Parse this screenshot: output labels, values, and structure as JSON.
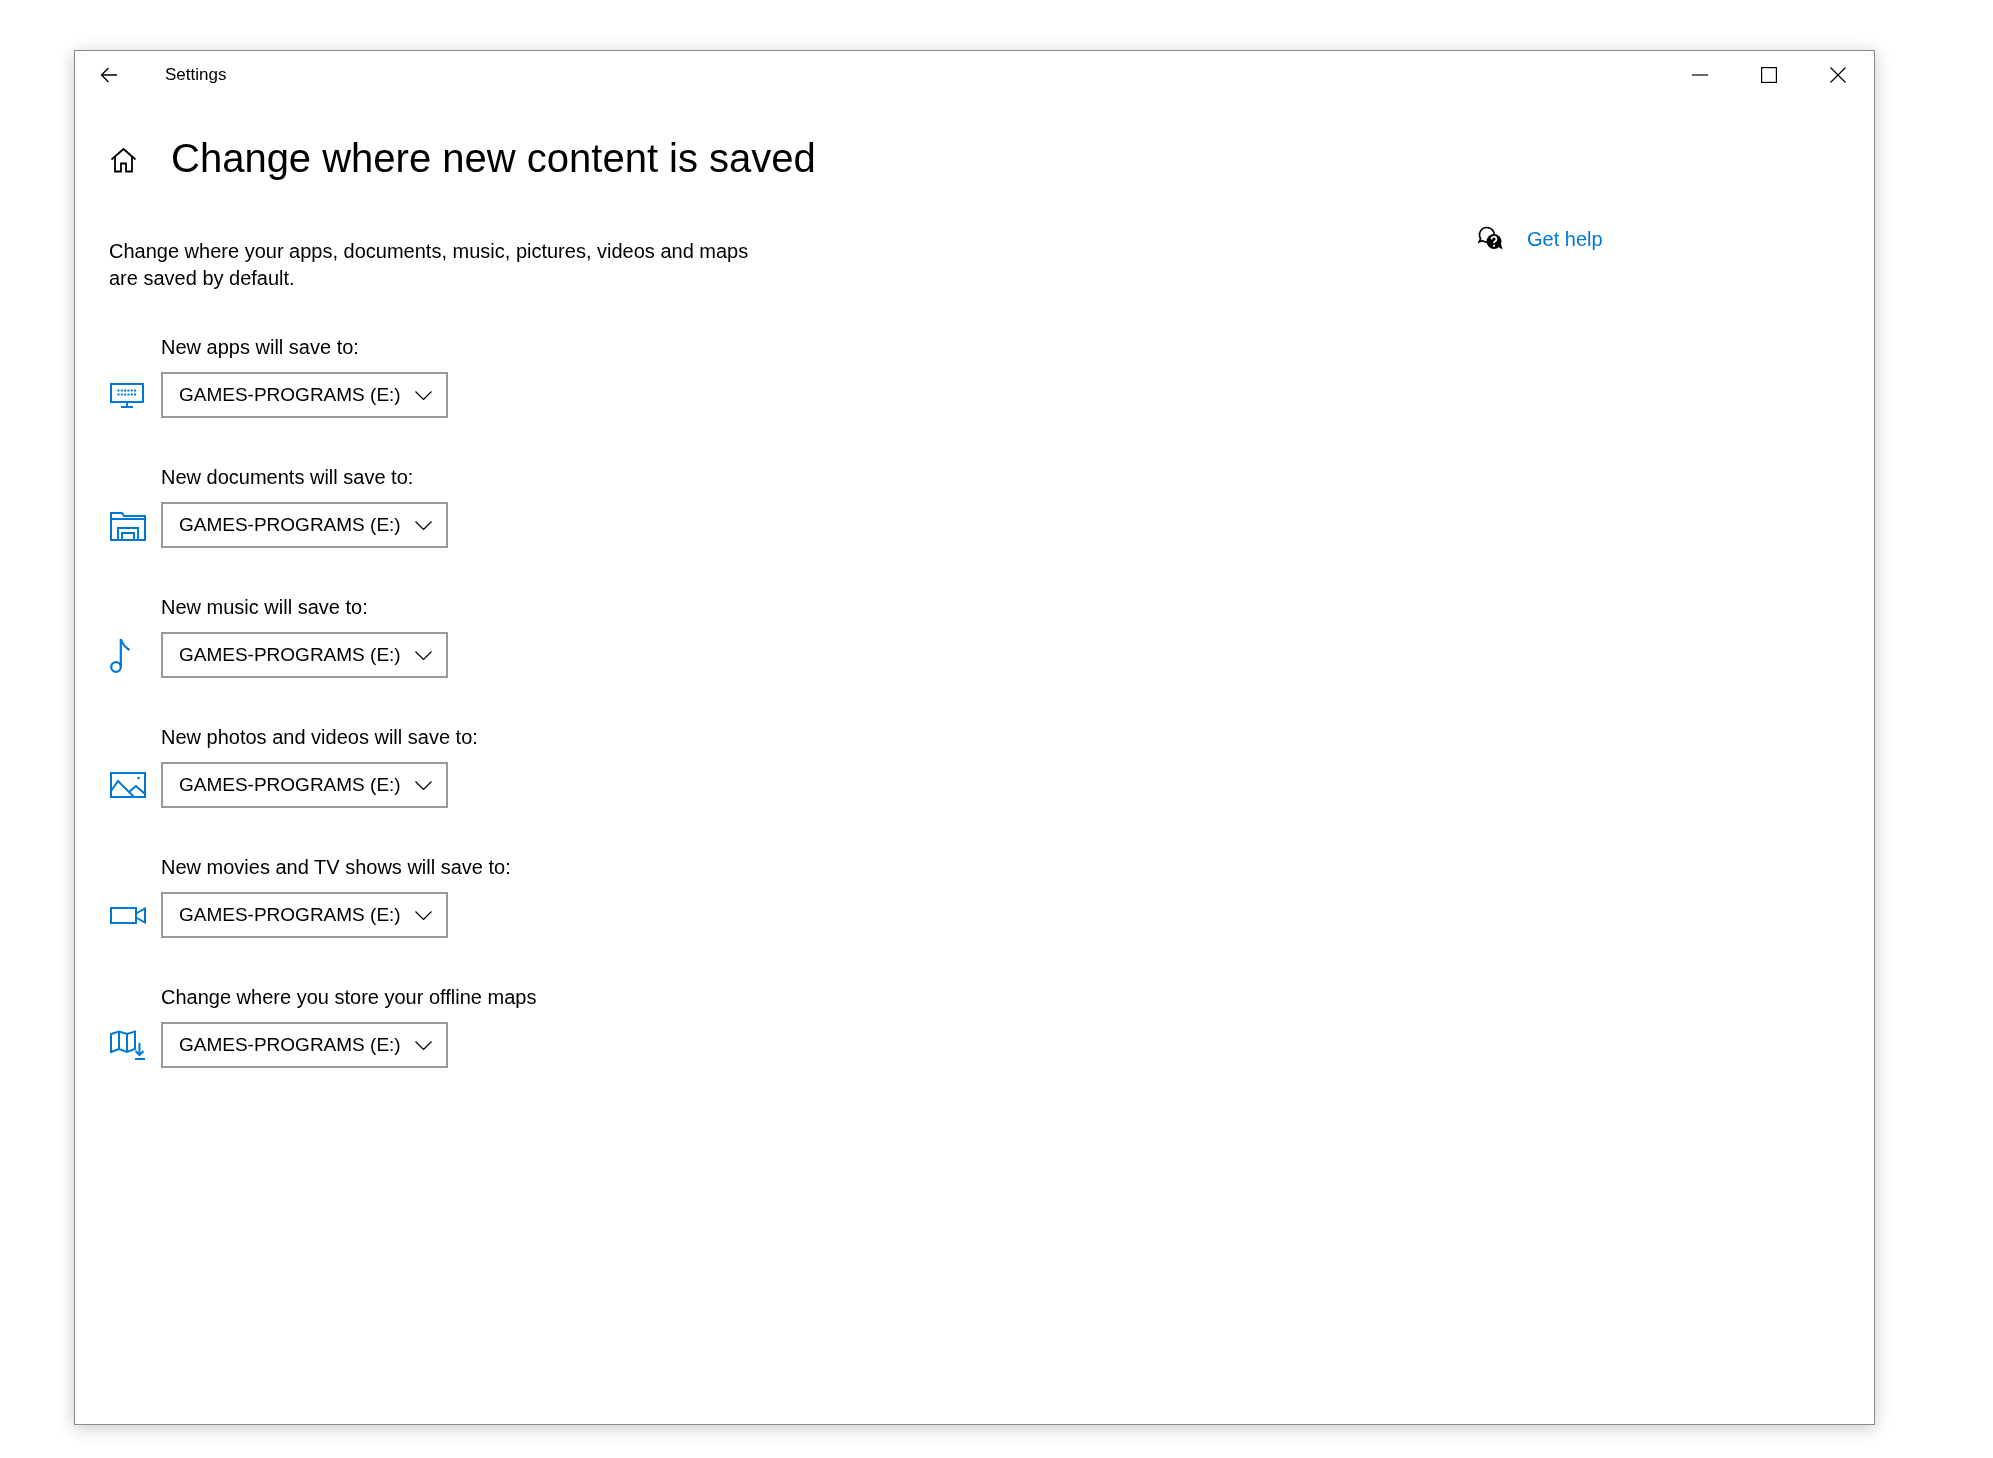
{
  "window": {
    "title": "Settings"
  },
  "page": {
    "title": "Change where new content is saved",
    "description": "Change where your apps, documents, music, pictures, videos and maps are saved by default."
  },
  "help_link": {
    "label": "Get help"
  },
  "locations": [
    {
      "kind": "apps",
      "label": "New apps will save to:",
      "value": "GAMES-PROGRAMS (E:)"
    },
    {
      "kind": "documents",
      "label": "New documents will save to:",
      "value": "GAMES-PROGRAMS (E:)"
    },
    {
      "kind": "music",
      "label": "New music will save to:",
      "value": "GAMES-PROGRAMS (E:)"
    },
    {
      "kind": "photos",
      "label": "New photos and videos will save to:",
      "value": "GAMES-PROGRAMS (E:)"
    },
    {
      "kind": "movies",
      "label": "New movies and TV shows will save to:",
      "value": "GAMES-PROGRAMS (E:)"
    },
    {
      "kind": "maps",
      "label": "Change where you store your offline maps",
      "value": "GAMES-PROGRAMS (E:)"
    }
  ]
}
